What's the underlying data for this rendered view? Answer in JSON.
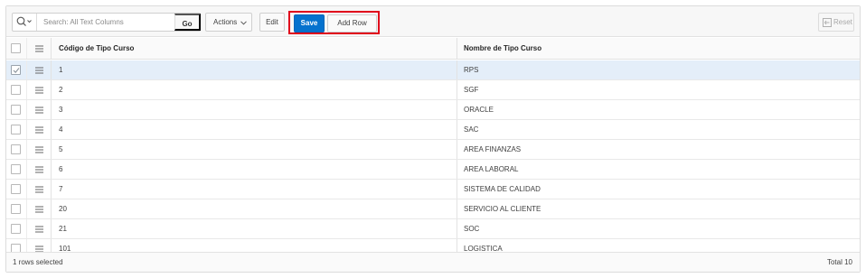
{
  "toolbar": {
    "search_icon": "magnifier-icon",
    "search_placeholder": "Search: All Text Columns",
    "search_value": "",
    "go_label": "Go",
    "actions_label": "Actions",
    "edit_label": "Edit",
    "save_label": "Save",
    "add_row_label": "Add Row",
    "reset_label": "Reset",
    "highlight_color": "#e0001b",
    "save_color": "#0572ce"
  },
  "grid": {
    "columns": [
      "Código de Tipo Curso",
      "Nombre de Tipo Curso"
    ],
    "rows": [
      {
        "codigo": "1",
        "nombre": "RPS",
        "selected": true
      },
      {
        "codigo": "2",
        "nombre": "SGF",
        "selected": false
      },
      {
        "codigo": "3",
        "nombre": "ORACLE",
        "selected": false
      },
      {
        "codigo": "4",
        "nombre": "SAC",
        "selected": false
      },
      {
        "codigo": "5",
        "nombre": "AREA FINANZAS",
        "selected": false
      },
      {
        "codigo": "6",
        "nombre": "AREA LABORAL",
        "selected": false
      },
      {
        "codigo": "7",
        "nombre": "SISTEMA DE CALIDAD",
        "selected": false
      },
      {
        "codigo": "20",
        "nombre": "SERVICIO AL CLIENTE",
        "selected": false
      },
      {
        "codigo": "21",
        "nombre": "SOC",
        "selected": false
      },
      {
        "codigo": "101",
        "nombre": "LOGISTICA",
        "selected": false
      }
    ],
    "selected_row_color": "#e4eef9"
  },
  "footer": {
    "selection_status": "1 rows selected",
    "total": "Total 10"
  }
}
